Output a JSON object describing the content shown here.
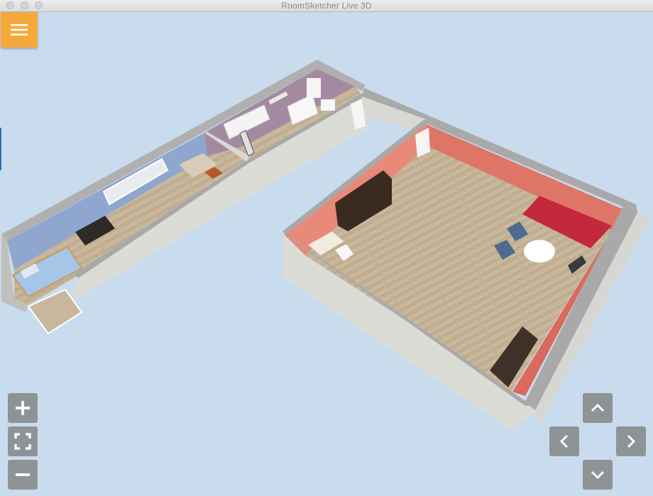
{
  "window": {
    "title": "RoomSketcher Live 3D",
    "traffic_lights": [
      "close-button",
      "minimize-button",
      "zoom-button"
    ]
  },
  "menu": {
    "icon": "hamburger-menu-icon"
  },
  "view": {
    "background_color": "#c9dcee",
    "wall_colors": {
      "bedroom": "#8fa7cf",
      "bathroom": "#a48aa0",
      "living_room": "#de7668"
    },
    "floor_color": "#c7b496"
  },
  "zoom_controls": [
    {
      "name": "zoom-in-button",
      "icon": "plus-icon"
    },
    {
      "name": "fit-view-button",
      "icon": "fullscreen-icon"
    },
    {
      "name": "zoom-out-button",
      "icon": "minus-icon"
    }
  ],
  "pan_controls": [
    {
      "name": "pan-up-button",
      "icon": "chevron-up-icon"
    },
    {
      "name": "pan-left-button",
      "icon": "chevron-left-icon"
    },
    {
      "name": "pan-right-button",
      "icon": "chevron-right-icon"
    },
    {
      "name": "pan-down-button",
      "icon": "chevron-down-icon"
    }
  ],
  "accent_color": "#f6a93b"
}
